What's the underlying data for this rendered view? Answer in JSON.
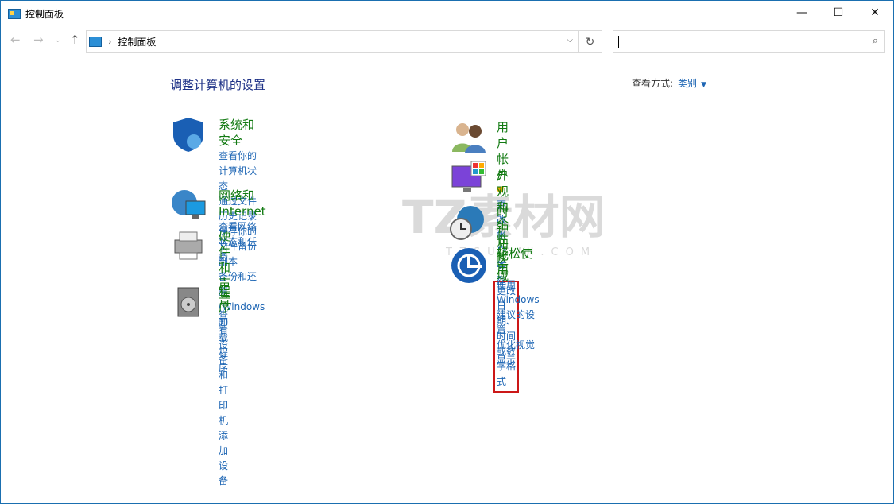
{
  "window": {
    "title": "控制面板"
  },
  "nav": {
    "breadcrumb": "控制面板",
    "search_placeholder": ""
  },
  "main": {
    "heading": "调整计算机的设置",
    "view_by_label": "查看方式:",
    "view_by_value": "类别",
    "left": [
      {
        "title": "系统和安全",
        "links": [
          "查看你的计算机状态",
          "通过文件历史记录保存你的文件备份副本",
          "备份和还原(Windows 7)"
        ]
      },
      {
        "title": "网络和 Internet",
        "links": [
          "查看网络状态和任务"
        ]
      },
      {
        "title": "硬件和声音",
        "links": [
          "查看设备和打印机",
          "添加设备"
        ]
      },
      {
        "title": "程序",
        "links": [
          "卸载程序"
        ]
      }
    ],
    "right": [
      {
        "title": "用户帐户",
        "links": [
          "更改帐户类型"
        ]
      },
      {
        "title": "外观和个性化",
        "links": []
      },
      {
        "title": "时钟和区域",
        "links": [
          "更改日期、时间或数字格式"
        ]
      },
      {
        "title": "轻松使用",
        "links": [
          "使用 Windows 建议的设置",
          "优化视觉显示"
        ]
      }
    ]
  },
  "watermark": {
    "text": "TZ素材网",
    "sub": "TZSUCAI.COM"
  },
  "colors": {
    "link": "#1e66b4",
    "category": "#127a12",
    "highlight": "#cc1818"
  }
}
